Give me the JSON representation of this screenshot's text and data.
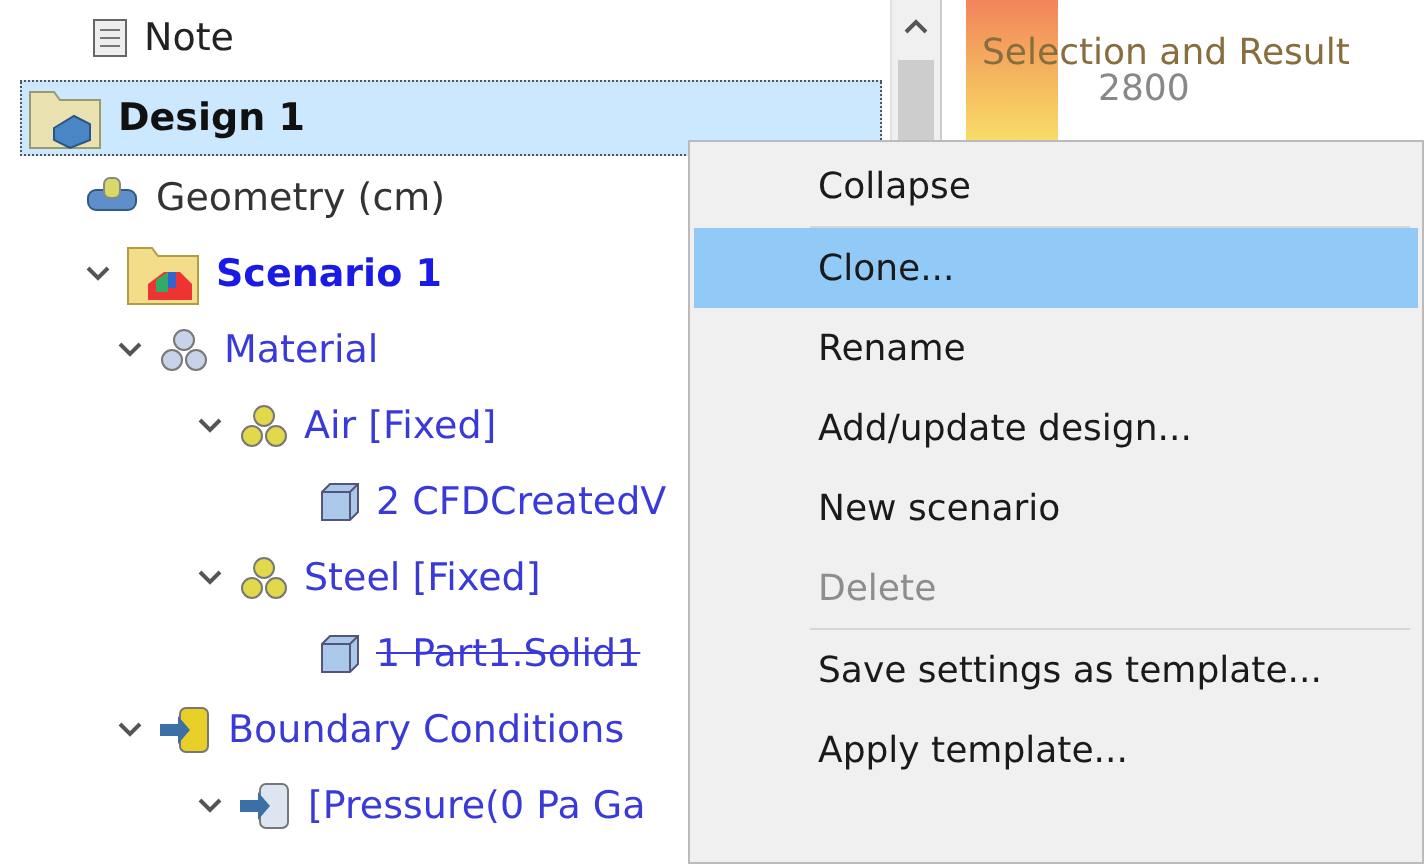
{
  "tree": [
    {
      "label": "Note",
      "kind": "note"
    },
    {
      "label": "Design 1",
      "kind": "design",
      "selected": true
    },
    {
      "label": "Geometry (cm)",
      "kind": "geometry",
      "selected": false
    },
    {
      "label": "Scenario 1",
      "kind": "scenario",
      "expanded": true,
      "children": [
        {
          "label": "Material",
          "kind": "material",
          "expanded": true,
          "children": [
            {
              "label": "Air [Fixed]",
              "kind": "material-item",
              "expanded": true,
              "children": [
                {
                  "label": "2 CFDCreatedV",
                  "kind": "part",
                  "excluded": false
                }
              ]
            },
            {
              "label": "Steel [Fixed]",
              "kind": "material-item",
              "expanded": true,
              "children": [
                {
                  "label": "1 Part1.Solid1",
                  "kind": "part",
                  "excluded": true
                }
              ]
            }
          ]
        },
        {
          "label": "Boundary Conditions",
          "kind": "boundary",
          "expanded": true,
          "children": [
            {
              "label": "[Pressure(0 Pa Ga",
              "kind": "boundary-item",
              "expanded": true
            }
          ]
        }
      ]
    }
  ],
  "legend": {
    "title": "Selection and Result",
    "tick": "2800"
  },
  "context_menu": {
    "groups": [
      [
        {
          "label": "Collapse",
          "disabled": false,
          "selected": false
        }
      ],
      [
        {
          "label": "Clone...",
          "disabled": false,
          "selected": true
        },
        {
          "label": "Rename",
          "disabled": false,
          "selected": false
        },
        {
          "label": "Add/update design...",
          "disabled": false,
          "selected": false
        },
        {
          "label": "New scenario",
          "disabled": false,
          "selected": false
        },
        {
          "label": "Delete",
          "disabled": true,
          "selected": false
        }
      ],
      [
        {
          "label": "Save settings as template...",
          "disabled": false,
          "selected": false
        },
        {
          "label": "Apply template...",
          "disabled": false,
          "selected": false
        }
      ]
    ]
  }
}
